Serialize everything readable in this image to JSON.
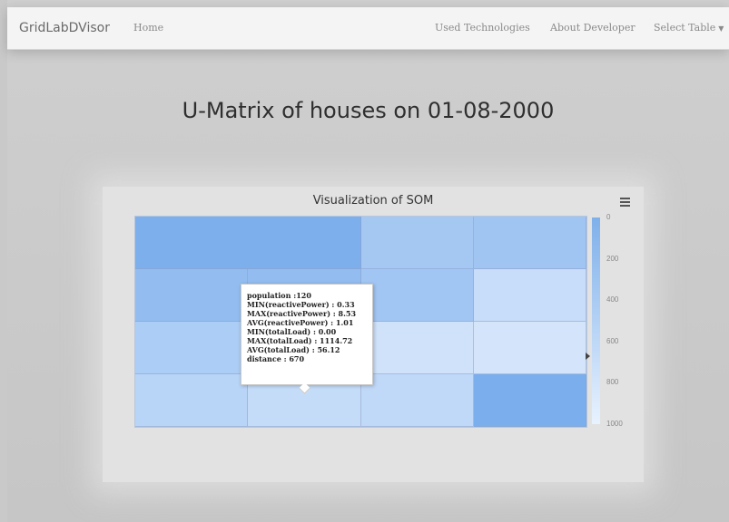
{
  "navbar": {
    "brand": "GridLabDVisor",
    "home": "Home",
    "used_technologies": "Used Technologies",
    "about_developer": "About Developer",
    "select_table": "Select Table"
  },
  "page_title": "U-Matrix of houses on 01-08-2000",
  "chart_data": {
    "type": "heatmap",
    "title": "Visualization of SOM",
    "rows": 4,
    "cols": 4,
    "colorbar_ticks": [
      "0",
      "200",
      "400",
      "600",
      "800",
      "1000"
    ],
    "colorbar_range": [
      0,
      1000
    ],
    "cells": [
      {
        "row": 0,
        "col": 0,
        "value": 880,
        "colspan": 2
      },
      {
        "row": 0,
        "col": 2,
        "value": 560
      },
      {
        "row": 0,
        "col": 3,
        "value": 600
      },
      {
        "row": 1,
        "col": 0,
        "value": 700
      },
      {
        "row": 1,
        "col": 1,
        "value": 700
      },
      {
        "row": 1,
        "col": 2,
        "value": 580
      },
      {
        "row": 1,
        "col": 3,
        "value": 280
      },
      {
        "row": 2,
        "col": 0,
        "value": 500
      },
      {
        "row": 2,
        "col": 1,
        "value": 640
      },
      {
        "row": 2,
        "col": 2,
        "value": 220
      },
      {
        "row": 2,
        "col": 3,
        "value": 180
      },
      {
        "row": 3,
        "col": 0,
        "value": 400
      },
      {
        "row": 3,
        "col": 1,
        "value": 300
      },
      {
        "row": 3,
        "col": 2,
        "value": 340
      },
      {
        "row": 3,
        "col": 3,
        "value": 900
      }
    ],
    "colors": {
      "low": "#eaf3ff",
      "high": "#6ea6ea"
    },
    "tooltip": [
      "population :120",
      "MIN(reactivePower) : 0.33",
      "MAX(reactivePower) : 8.53",
      "AVG(reactivePower) : 1.01",
      "MIN(totalLoad) : 0.00",
      "MAX(totalLoad) : 1114.72",
      "AVG(totalLoad) : 56.12",
      " distance : 670"
    ],
    "colorbar_marker_value": 670
  }
}
